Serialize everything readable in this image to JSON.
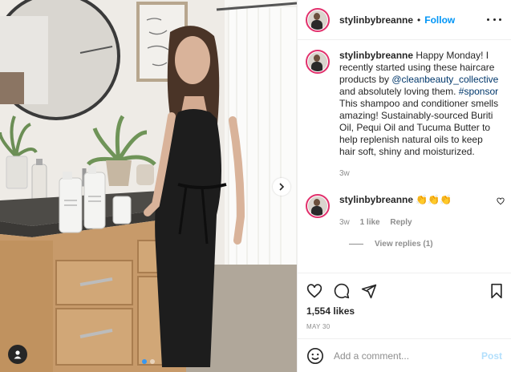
{
  "post": {
    "username": "stylinbybreanne",
    "separator": "•",
    "follow_label": "Follow",
    "more_icon": "more-options-icon"
  },
  "caption": {
    "username": "stylinbybreanne",
    "text_1": " Happy Monday! I recently started using these haircare products by ",
    "mention": "@cleanbeauty_collective",
    "text_2": " and absolutely loving them. ",
    "hashtag": "#sponsor",
    "text_3": " This shampoo and conditioner smells amazing! Sustainably-sourced Buriti Oil, Pequi Oil and Tucuma Butter to help replenish natural oils to keep hair soft, shiny and moisturized.",
    "age": "3w"
  },
  "reply": {
    "username": "stylinbybreanne",
    "text": " 👏👏👏",
    "age": "3w",
    "likes": "1 like",
    "reply_label": "Reply",
    "view_replies": "View replies (1)"
  },
  "engagement": {
    "likes": "1,554 likes",
    "date": "MAY 30"
  },
  "composer": {
    "placeholder": "Add a comment...",
    "post_label": "Post"
  },
  "colors": {
    "follow": "#0095f6",
    "post_disabled": "#b2dffc",
    "avatar_ring": "#e1306c"
  }
}
